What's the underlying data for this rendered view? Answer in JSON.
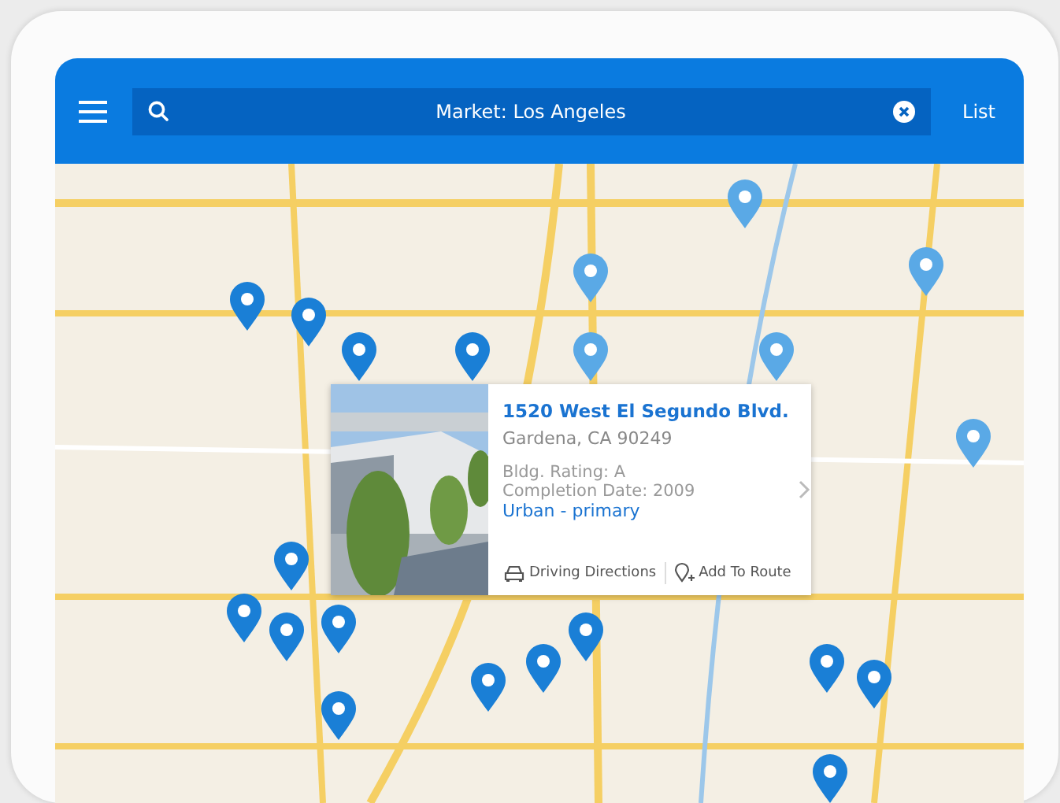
{
  "header": {
    "search": {
      "value": "Market: Los Angeles"
    },
    "list_button": "List"
  },
  "card": {
    "title": "1520 West El Segundo Blvd.",
    "address": "Gardena, CA 90249",
    "rating": "Bldg. Rating: A",
    "completion": "Completion Date: 2009",
    "category": "Urban - primary",
    "actions": [
      {
        "kind": "directions",
        "label": "Driving Directions"
      },
      {
        "kind": "route",
        "label": "Add To Route"
      }
    ]
  }
}
